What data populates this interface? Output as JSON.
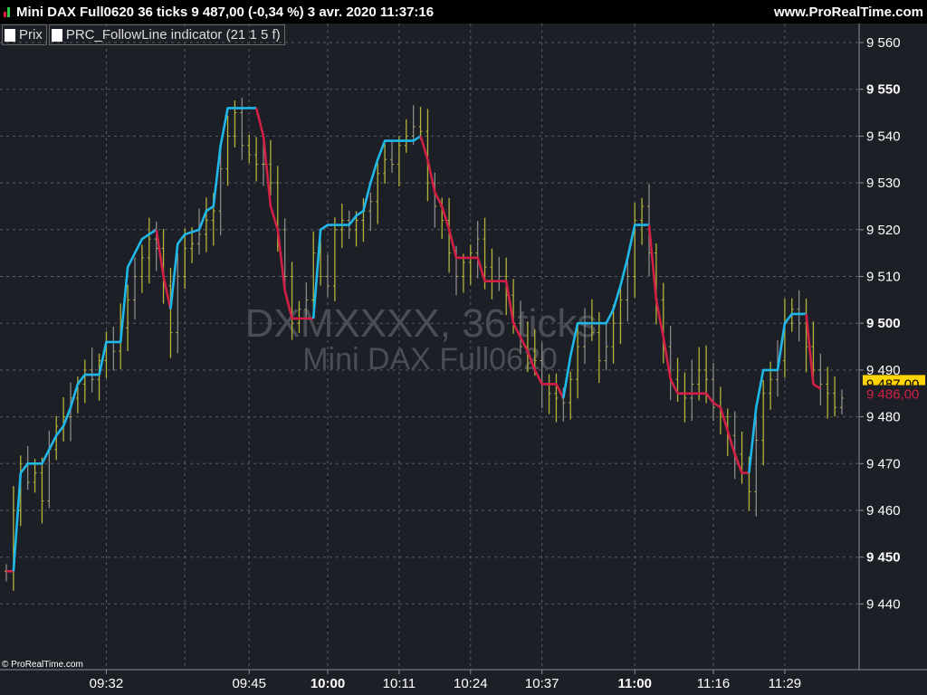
{
  "header": {
    "title": "Mini DAX Full0620 36 ticks 9 487,00 (-0,34 %) 3 avr. 2020 11:37:16",
    "site": "www.ProRealTime.com"
  },
  "legend": [
    {
      "label": "Prix"
    },
    {
      "label": "PRC_FollowLine indicator (21 1 5 f)"
    }
  ],
  "watermark": {
    "line1": "DXMXXXX, 36 ticks",
    "line2": "Mini DAX Full0620"
  },
  "copyright": "© ProRealTime.com",
  "colors": {
    "background": "#1d1f26",
    "bars": "#b3b23c",
    "bars_dim": "#8a8a8a",
    "line_up": "#1fb8e8",
    "line_down": "#d21f45",
    "last_price_bg": "#ffd400",
    "grid": "#5a5c62"
  },
  "chart_data": {
    "type": "line",
    "title": "Mini DAX Full0620 36 ticks",
    "xlabel": "",
    "ylabel": "",
    "ylim": [
      9430,
      9565
    ],
    "grid": true,
    "y_ticks": [
      {
        "value": 9560,
        "label": "9 560",
        "bold": false
      },
      {
        "value": 9550,
        "label": "9 550",
        "bold": true
      },
      {
        "value": 9540,
        "label": "9 540",
        "bold": false
      },
      {
        "value": 9530,
        "label": "9 530",
        "bold": false
      },
      {
        "value": 9520,
        "label": "9 520",
        "bold": false
      },
      {
        "value": 9510,
        "label": "9 510",
        "bold": false
      },
      {
        "value": 9500,
        "label": "9 500",
        "bold": true
      },
      {
        "value": 9490,
        "label": "9 490",
        "bold": false
      },
      {
        "value": 9480,
        "label": "9 480",
        "bold": false
      },
      {
        "value": 9470,
        "label": "9 470",
        "bold": false
      },
      {
        "value": 9460,
        "label": "9 460",
        "bold": false
      },
      {
        "value": 9450,
        "label": "9 450",
        "bold": true
      },
      {
        "value": 9440,
        "label": "9 440",
        "bold": false
      }
    ],
    "x_ticks": [
      {
        "index": 14,
        "label": "09:32",
        "bold": false
      },
      {
        "index": 34,
        "label": "09:45",
        "bold": false
      },
      {
        "index": 45,
        "label": "10:00",
        "bold": true
      },
      {
        "index": 55,
        "label": "10:11",
        "bold": false
      },
      {
        "index": 65,
        "label": "10:24",
        "bold": false
      },
      {
        "index": 75,
        "label": "10:37",
        "bold": false
      },
      {
        "index": 88,
        "label": "11:00",
        "bold": true
      },
      {
        "index": 99,
        "label": "11:16",
        "bold": false
      },
      {
        "index": 109,
        "label": "11:29",
        "bold": false
      }
    ],
    "x_grid_indices": [
      14,
      25,
      34,
      45,
      55,
      65,
      75,
      88,
      99,
      109
    ],
    "n_bars": 118,
    "last_price": {
      "value": 9487.0,
      "label": "9 487,00"
    },
    "indicator_value": {
      "value": 9486.0,
      "label": "9 486,00"
    },
    "series": [
      {
        "name": "PRC_FollowLine indicator (21 1 5 f)",
        "segments": [
          {
            "trend": "down",
            "points": [
              [
                0,
                9447
              ],
              [
                1,
                9447
              ]
            ]
          },
          {
            "trend": "up",
            "points": [
              [
                1,
                9447
              ],
              [
                2,
                9468
              ],
              [
                3,
                9470
              ],
              [
                5,
                9470
              ],
              [
                6,
                9473
              ],
              [
                7,
                9476
              ],
              [
                8,
                9478
              ],
              [
                9,
                9482
              ],
              [
                10,
                9487
              ],
              [
                11,
                9489
              ],
              [
                13,
                9489
              ],
              [
                14,
                9496
              ],
              [
                16,
                9496
              ],
              [
                17,
                9512
              ],
              [
                19,
                9518
              ],
              [
                21,
                9520
              ]
            ]
          },
          {
            "trend": "down",
            "points": [
              [
                21,
                9520
              ],
              [
                22,
                9510
              ],
              [
                23,
                9503
              ]
            ]
          },
          {
            "trend": "up",
            "points": [
              [
                23,
                9503
              ],
              [
                24,
                9517
              ],
              [
                25,
                9519
              ],
              [
                27,
                9520
              ],
              [
                28,
                9524
              ],
              [
                29,
                9525
              ],
              [
                30,
                9538
              ],
              [
                31,
                9546
              ],
              [
                35,
                9546
              ]
            ]
          },
          {
            "trend": "down",
            "points": [
              [
                35,
                9546
              ],
              [
                36,
                9540
              ],
              [
                37,
                9525
              ],
              [
                38,
                9520
              ],
              [
                39,
                9507
              ],
              [
                40,
                9501
              ],
              [
                43,
                9501
              ]
            ]
          },
          {
            "trend": "up",
            "points": [
              [
                43,
                9501
              ],
              [
                44,
                9520
              ],
              [
                45,
                9521
              ],
              [
                48,
                9521
              ],
              [
                49,
                9523
              ],
              [
                50,
                9524
              ],
              [
                51,
                9530
              ],
              [
                52,
                9535
              ],
              [
                53,
                9539
              ],
              [
                57,
                9539
              ],
              [
                58,
                9540
              ]
            ]
          },
          {
            "trend": "down",
            "points": [
              [
                58,
                9540
              ],
              [
                59,
                9535
              ],
              [
                60,
                9528
              ],
              [
                61,
                9525
              ],
              [
                62,
                9520
              ],
              [
                63,
                9514
              ],
              [
                66,
                9514
              ],
              [
                67,
                9509
              ],
              [
                70,
                9509
              ],
              [
                71,
                9500
              ],
              [
                72,
                9497
              ],
              [
                73,
                9494
              ],
              [
                74,
                9490
              ],
              [
                75,
                9487
              ],
              [
                77,
                9487
              ],
              [
                78,
                9484
              ]
            ]
          },
          {
            "trend": "up",
            "points": [
              [
                78,
                9484
              ],
              [
                79,
                9493
              ],
              [
                80,
                9500
              ],
              [
                84,
                9500
              ],
              [
                85,
                9503
              ],
              [
                86,
                9508
              ],
              [
                87,
                9514
              ],
              [
                88,
                9521
              ],
              [
                90,
                9521
              ]
            ]
          },
          {
            "trend": "down",
            "points": [
              [
                90,
                9521
              ],
              [
                91,
                9505
              ],
              [
                92,
                9497
              ],
              [
                93,
                9488
              ],
              [
                94,
                9485
              ],
              [
                98,
                9485
              ],
              [
                99,
                9483
              ],
              [
                100,
                9482
              ],
              [
                101,
                9477
              ],
              [
                102,
                9472
              ],
              [
                103,
                9468
              ],
              [
                104,
                9468
              ]
            ]
          },
          {
            "trend": "up",
            "points": [
              [
                104,
                9468
              ],
              [
                105,
                9482
              ],
              [
                106,
                9490
              ],
              [
                108,
                9490
              ],
              [
                109,
                9500
              ],
              [
                110,
                9502
              ],
              [
                112,
                9502
              ]
            ]
          },
          {
            "trend": "down",
            "points": [
              [
                112,
                9502
              ],
              [
                113,
                9487
              ],
              [
                114,
                9486
              ]
            ]
          }
        ]
      },
      {
        "name": "Prix",
        "close": [
          9447,
          9460,
          9470,
          9466,
          9468,
          9462,
          9473,
          9478,
          9480,
          9484,
          9487,
          9490,
          9488,
          9492,
          9496,
          9494,
          9499,
          9505,
          9510,
          9514,
          9518,
          9516,
          9508,
          9498,
          9510,
          9516,
          9517,
          9519,
          9522,
          9524,
          9533,
          9540,
          9545,
          9538,
          9536,
          9534,
          9534,
          9530,
          9520,
          9510,
          9500,
          9503,
          9505,
          9515,
          9510,
          9508,
          9520,
          9522,
          9520,
          9522,
          9524,
          9526,
          9532,
          9535,
          9534,
          9538,
          9540,
          9542,
          9541,
          9530,
          9525,
          9522,
          9515,
          9510,
          9513,
          9515,
          9518,
          9512,
          9509,
          9510,
          9506,
          9500,
          9495,
          9494,
          9492,
          9487,
          9485,
          9484,
          9483,
          9488,
          9495,
          9500,
          9498,
          9492,
          9495,
          9500,
          9505,
          9510,
          9522,
          9525,
          9515,
          9505,
          9495,
          9488,
          9485,
          9484,
          9487,
          9490,
          9488,
          9482,
          9480,
          9476,
          9472,
          9468,
          9464,
          9475,
          9485,
          9488,
          9492,
          9500,
          9503,
          9500,
          9495,
          9490,
          9487,
          9485,
          9482,
          9484
        ]
      }
    ]
  }
}
